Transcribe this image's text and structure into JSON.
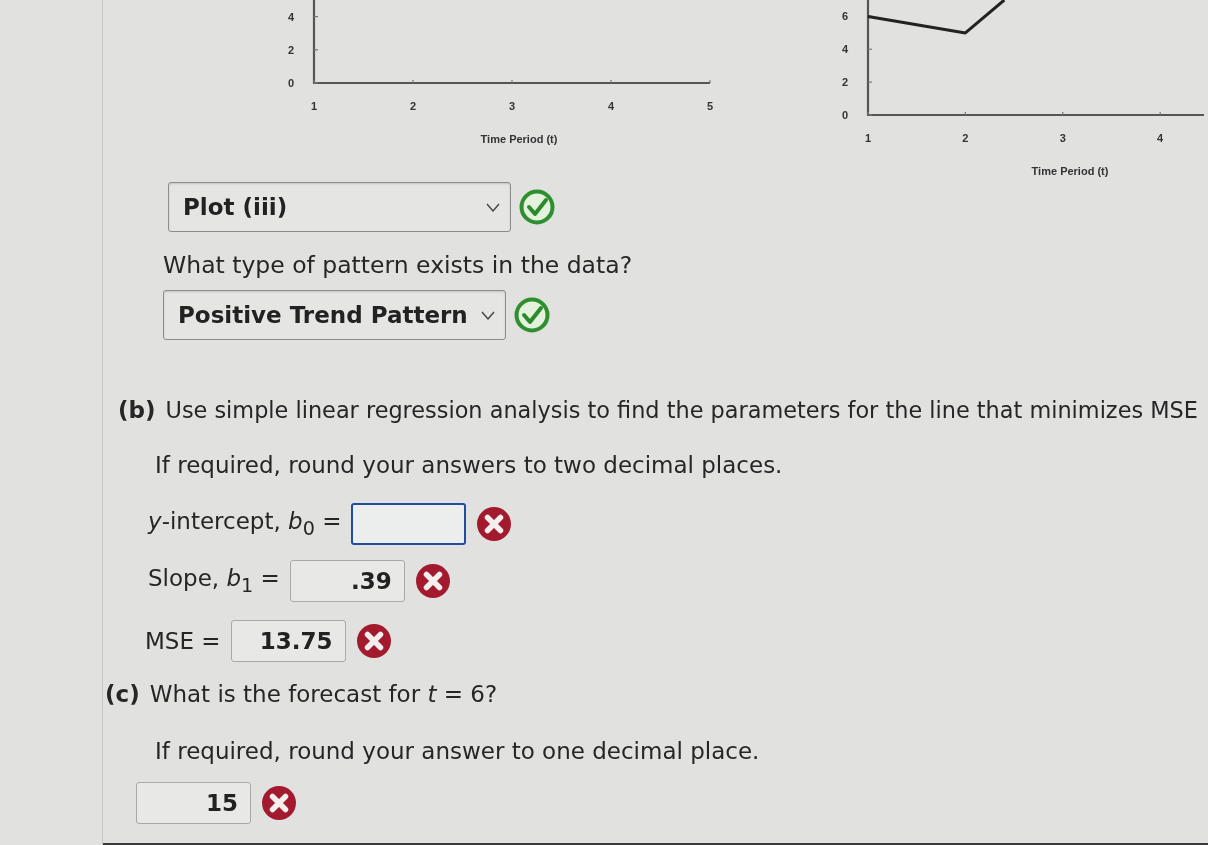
{
  "charts": [
    {
      "chart_data": [
        {
          "type": "line",
          "xlabel": "Time Period (t)",
          "xticks": [
            1,
            2,
            3,
            4,
            5
          ],
          "yticks": [
            0,
            2,
            4
          ],
          "xlim": [
            1,
            5
          ],
          "ylim": [
            0,
            5
          ]
        }
      ]
    },
    {
      "chart_data": [
        {
          "type": "line",
          "xlabel": "Time Period (t)",
          "x": [
            1,
            2,
            2.4
          ],
          "values": [
            6,
            5,
            7
          ],
          "xticks": [
            1,
            2,
            3,
            4
          ],
          "yticks": [
            0,
            2,
            4,
            6
          ],
          "xlim": [
            1,
            4.45
          ],
          "ylim": [
            0,
            7
          ]
        }
      ]
    }
  ],
  "part_a": {
    "plot_select": {
      "value": "Plot (iii)",
      "correct": true
    },
    "question": "What type of pattern exists in the data?",
    "pattern_select": {
      "value": "Positive Trend Pattern",
      "correct": true
    }
  },
  "part_b": {
    "label": "(b)",
    "prompt": "Use simple linear regression analysis to find the parameters for the line that minimizes MSE",
    "instruction": "If required, round your answers to two decimal places.",
    "fields": [
      {
        "label": "*y*-intercept, *b*$_{0}$ =",
        "focused": true,
        "correct": false
      },
      {
        "label": "Slope, *b*$_{1}$ =",
        "value": ".39",
        "focused": false,
        "correct": false
      },
      {
        "label": "MSE =",
        "value": "13.75",
        "focused": false,
        "correct": false
      }
    ]
  },
  "part_c": {
    "label": "(c)",
    "prompt": "What is the forecast for *t* = 6?",
    "instruction": "If required, round your answer to one decimal place.",
    "field": {
      "value": "15",
      "focused": false,
      "correct": false
    }
  }
}
